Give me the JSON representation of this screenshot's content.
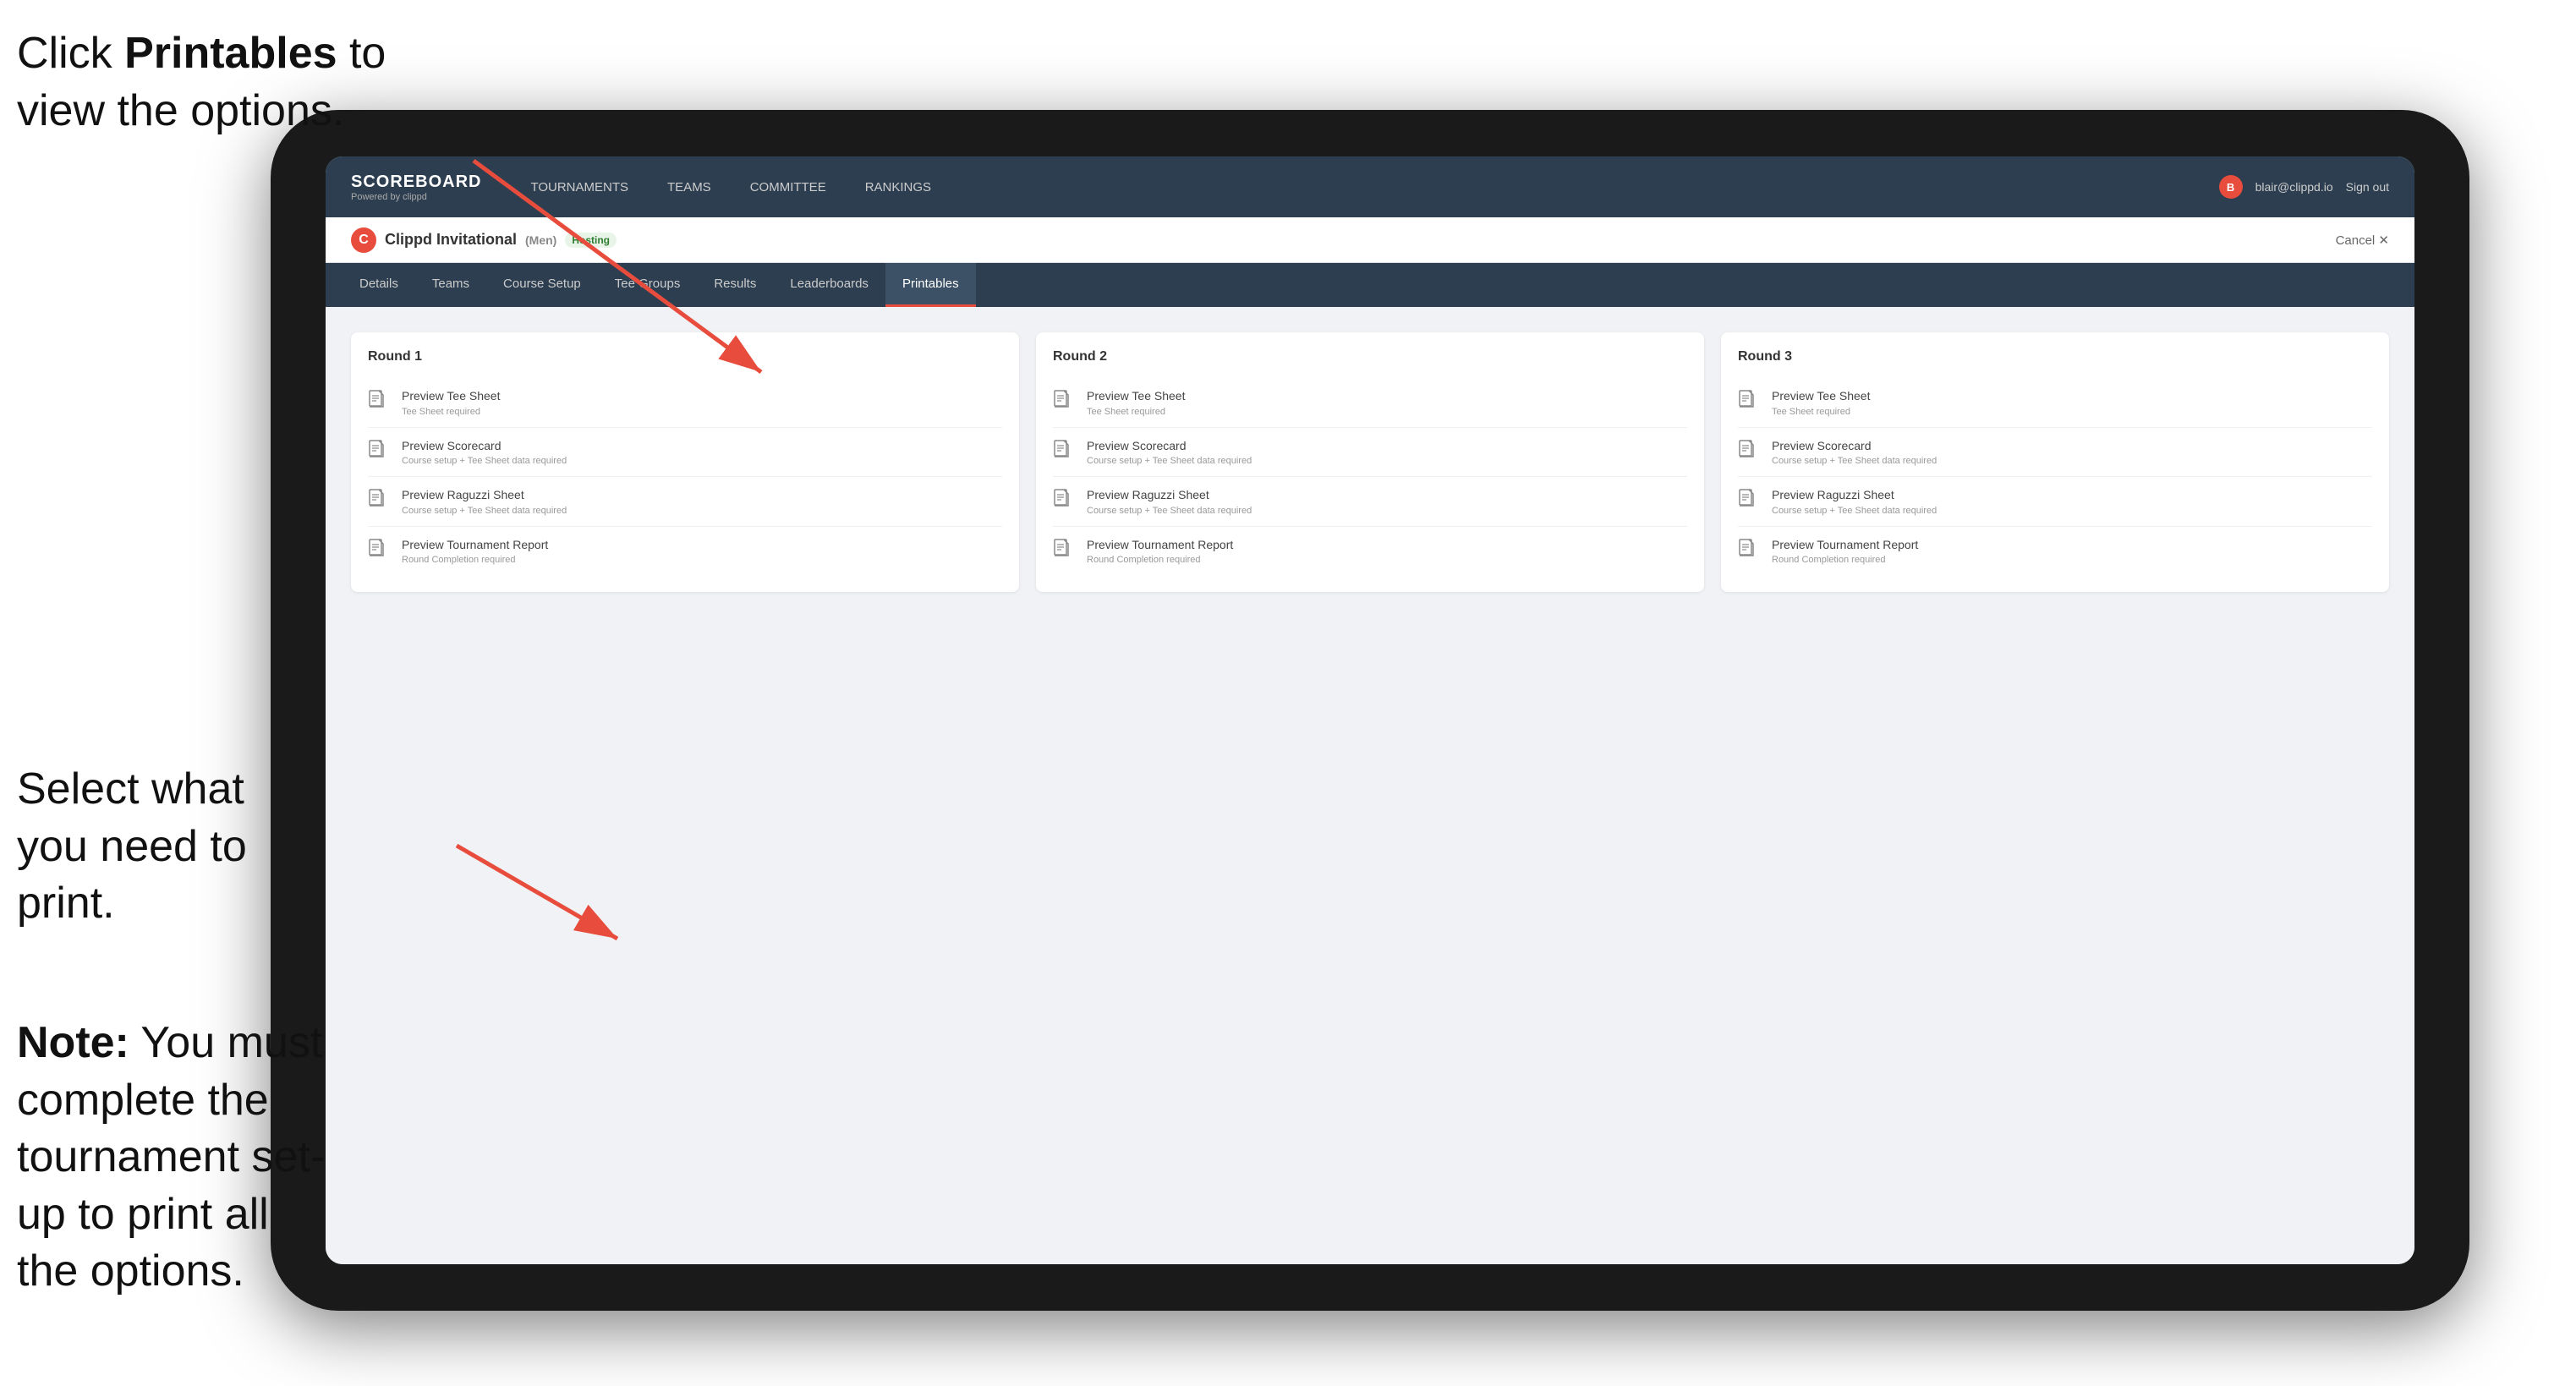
{
  "annotations": {
    "top": {
      "line1": "Click ",
      "bold": "Printables",
      "line1_end": " to",
      "line2": "view the options."
    },
    "middle": "Select what you need to print.",
    "bottom_bold": "Note:",
    "bottom_text": " You must complete the tournament set-up to print all the options."
  },
  "topNav": {
    "brand": "SCOREBOARD",
    "brandSub": "Powered by clippd",
    "links": [
      "TOURNAMENTS",
      "TEAMS",
      "COMMITTEE",
      "RANKINGS"
    ],
    "userEmail": "blair@clippd.io",
    "signOut": "Sign out"
  },
  "subHeader": {
    "tournamentName": "Clippd Invitational",
    "bracket": "(Men)",
    "status": "Hosting",
    "cancel": "Cancel ✕"
  },
  "tabs": [
    {
      "label": "Details",
      "active": false
    },
    {
      "label": "Teams",
      "active": false
    },
    {
      "label": "Course Setup",
      "active": false
    },
    {
      "label": "Tee Groups",
      "active": false
    },
    {
      "label": "Results",
      "active": false
    },
    {
      "label": "Leaderboards",
      "active": false
    },
    {
      "label": "Printables",
      "active": true
    }
  ],
  "rounds": [
    {
      "title": "Round 1",
      "items": [
        {
          "title": "Preview Tee Sheet",
          "subtitle": "Tee Sheet required"
        },
        {
          "title": "Preview Scorecard",
          "subtitle": "Course setup + Tee Sheet data required"
        },
        {
          "title": "Preview Raguzzi Sheet",
          "subtitle": "Course setup + Tee Sheet data required"
        },
        {
          "title": "Preview Tournament Report",
          "subtitle": "Round Completion required"
        }
      ]
    },
    {
      "title": "Round 2",
      "items": [
        {
          "title": "Preview Tee Sheet",
          "subtitle": "Tee Sheet required"
        },
        {
          "title": "Preview Scorecard",
          "subtitle": "Course setup + Tee Sheet data required"
        },
        {
          "title": "Preview Raguzzi Sheet",
          "subtitle": "Course setup + Tee Sheet data required"
        },
        {
          "title": "Preview Tournament Report",
          "subtitle": "Round Completion required"
        }
      ]
    },
    {
      "title": "Round 3",
      "items": [
        {
          "title": "Preview Tee Sheet",
          "subtitle": "Tee Sheet required"
        },
        {
          "title": "Preview Scorecard",
          "subtitle": "Course setup + Tee Sheet data required"
        },
        {
          "title": "Preview Raguzzi Sheet",
          "subtitle": "Course setup + Tee Sheet data required"
        },
        {
          "title": "Preview Tournament Report",
          "subtitle": "Round Completion required"
        }
      ]
    }
  ]
}
